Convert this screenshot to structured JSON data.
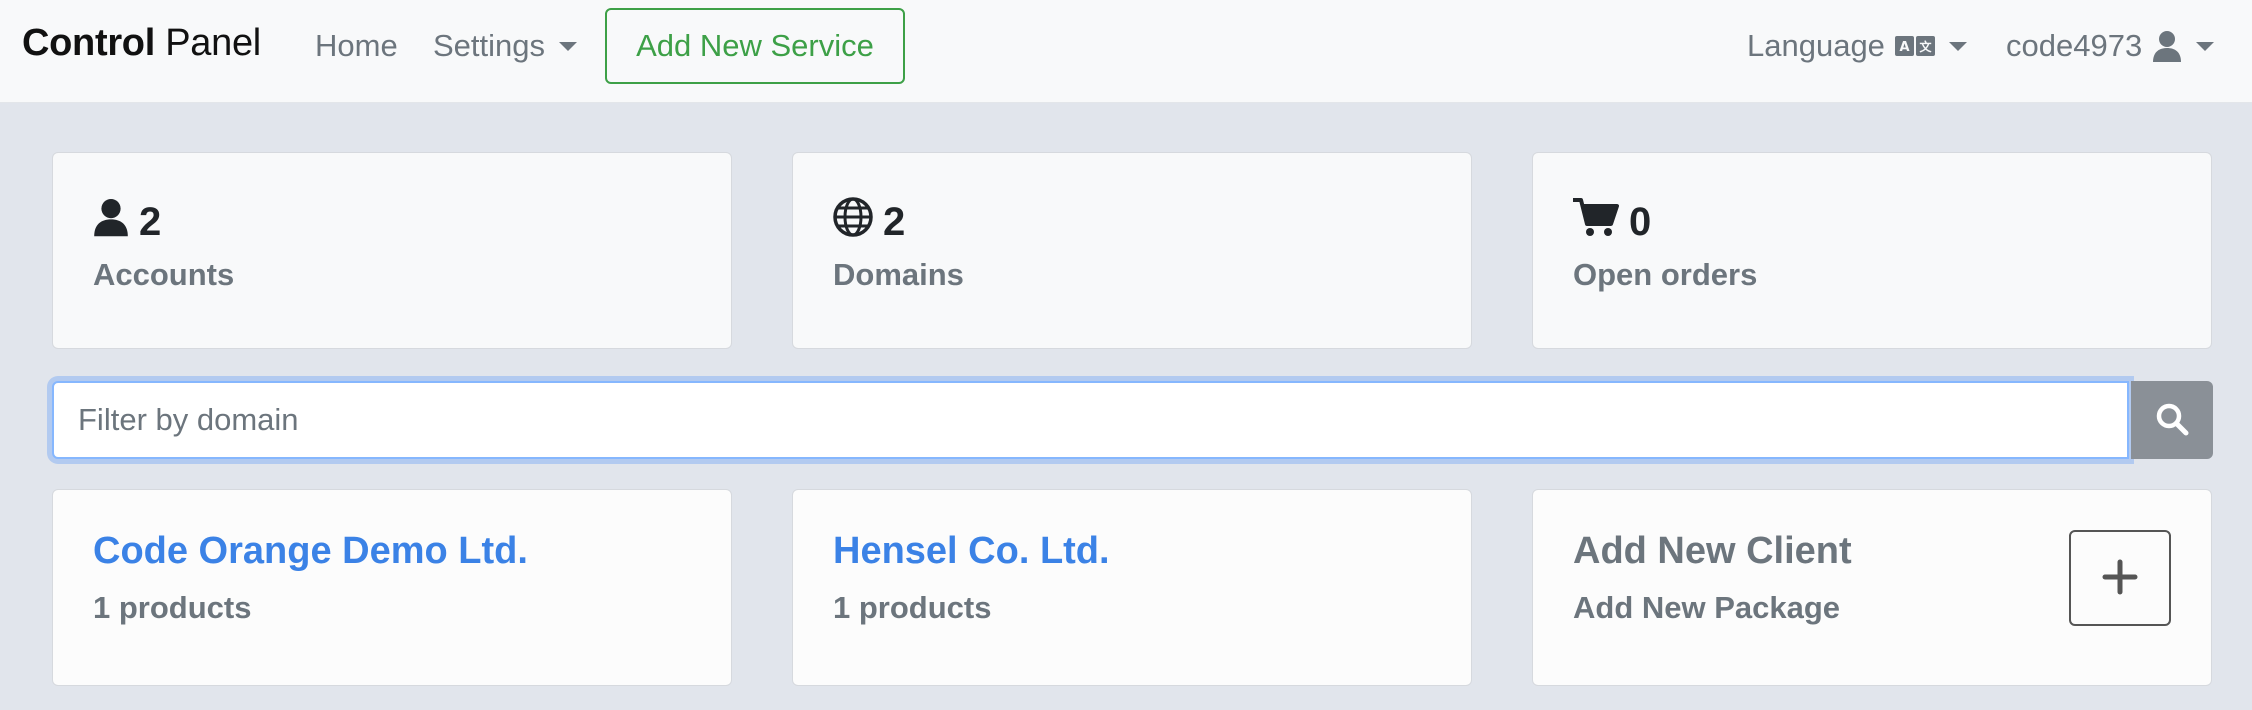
{
  "navbar": {
    "brand_bold": "Control",
    "brand_light": "Panel",
    "home": "Home",
    "settings": "Settings",
    "add_service": "Add New Service",
    "language": "Language",
    "language_icon": "translate-icon",
    "username": "code4973",
    "user_icon": "user-icon"
  },
  "stats": [
    {
      "icon": "user-icon",
      "value": "2",
      "label": "Accounts"
    },
    {
      "icon": "globe-icon",
      "value": "2",
      "label": "Domains"
    },
    {
      "icon": "cart-icon",
      "value": "0",
      "label": "Open orders"
    }
  ],
  "search": {
    "placeholder": "Filter by domain",
    "icon": "search-icon"
  },
  "clients": [
    {
      "name": "Code Orange Demo Ltd.",
      "products": "1 products"
    },
    {
      "name": "Hensel Co. Ltd.",
      "products": "1 products"
    }
  ],
  "add_client": {
    "title": "Add New Client",
    "subtitle": "Add New Package",
    "icon": "plus-icon"
  },
  "colors": {
    "success": "#3da047",
    "link": "#3b82e6",
    "muted": "#6c757d",
    "background": "#e1e5ec"
  }
}
